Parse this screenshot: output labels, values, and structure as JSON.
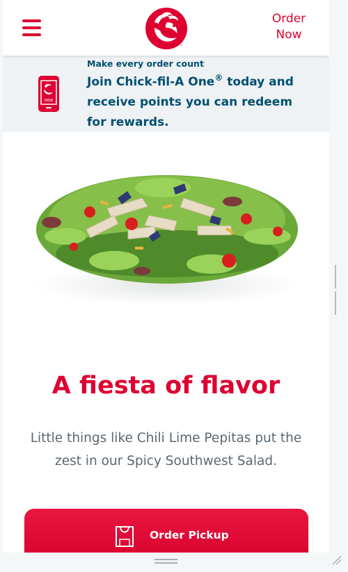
{
  "header": {
    "order_now_line1": "Order",
    "order_now_line2": "Now",
    "menu_icon": "hamburger-menu-icon",
    "logo": "chick-fil-a-logo"
  },
  "promo": {
    "small_text": "Make every order count",
    "main_pre": "Join Chick-fil-A One",
    "registered": "®",
    "main_post": " today and receive points you can redeem for rewards.",
    "icon": "phone-app-icon"
  },
  "hero": {
    "image": "spicy-southwest-salad"
  },
  "content": {
    "headline": "A fiesta of flavor",
    "description": "Little things like Chili Lime Pepitas put the zest in our Spicy Southwest Salad.",
    "order_button_label": "Order Pickup",
    "order_button_icon": "bag-icon"
  },
  "colors": {
    "brand_red": "#dd0031",
    "navy": "#004f71",
    "gray_text": "#5b6770"
  }
}
